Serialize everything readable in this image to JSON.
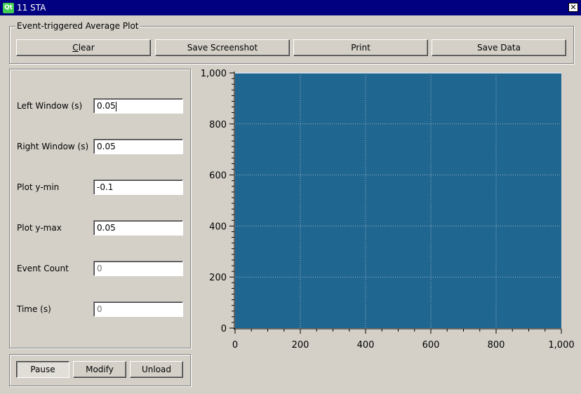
{
  "window": {
    "app_badge": "Qt",
    "title": "11 STA",
    "close_glyph": "✕"
  },
  "plot_group": {
    "title": "Event-triggered Average Plot",
    "buttons": {
      "clear": "Clear",
      "save_screenshot": "Save Screenshot",
      "print": "Print",
      "save_data": "Save Data"
    }
  },
  "params": {
    "left_window": {
      "label": "Left Window (s)",
      "value": "0.05"
    },
    "right_window": {
      "label": "Right Window (s)",
      "value": "0.05"
    },
    "plot_ymin": {
      "label": "Plot y-min",
      "value": "-0.1"
    },
    "plot_ymax": {
      "label": "Plot y-max",
      "value": "0.05"
    },
    "event_count": {
      "label": "Event Count",
      "placeholder": "0"
    },
    "time": {
      "label": "Time (s)",
      "placeholder": "0"
    }
  },
  "controls": {
    "pause": "Pause",
    "modify": "Modify",
    "unload": "Unload"
  },
  "chart_data": {
    "type": "line",
    "series": [],
    "xlim": [
      0,
      1000
    ],
    "ylim": [
      0,
      1000
    ],
    "x_ticks": [
      "0",
      "200",
      "400",
      "600",
      "800",
      "1,000"
    ],
    "y_ticks": [
      "0",
      "200",
      "400",
      "600",
      "800",
      "1,000"
    ],
    "grid": true,
    "background": "#1f6690",
    "grid_color": "#9fb6c8"
  }
}
